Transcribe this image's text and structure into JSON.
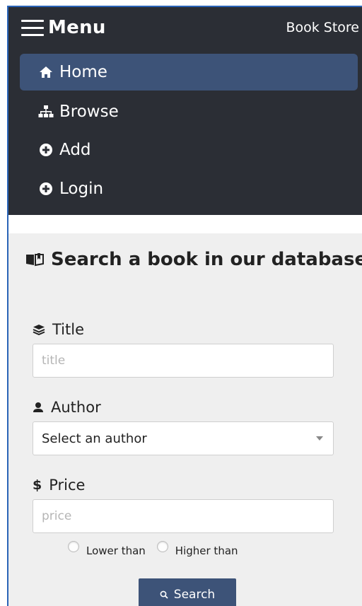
{
  "navbar": {
    "menu_label": "Menu",
    "brand": "Book Store",
    "items": [
      {
        "label": "Home",
        "icon": "home-icon",
        "active": true
      },
      {
        "label": "Browse",
        "icon": "sitemap-icon",
        "active": false
      },
      {
        "label": "Add",
        "icon": "plus-circle-icon",
        "active": false
      },
      {
        "label": "Login",
        "icon": "plus-circle-icon",
        "active": false
      }
    ]
  },
  "search": {
    "heading": "Search a book in our database",
    "title_label": "Title",
    "title_placeholder": "title",
    "author_label": "Author",
    "author_selected": "Select an author",
    "price_label": "Price",
    "price_placeholder": "price",
    "lower_than": "Lower than",
    "higher_than": "Higher than",
    "button_label": "Search"
  },
  "colors": {
    "navbar_bg": "#2b2e35",
    "accent": "#3d5378",
    "panel_bg": "#efefef"
  }
}
